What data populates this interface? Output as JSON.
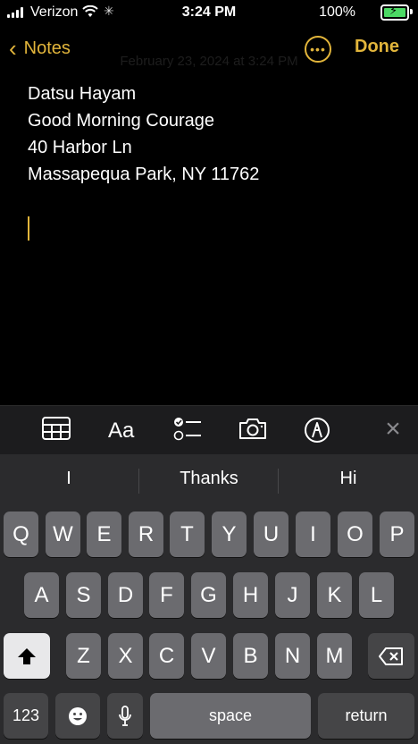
{
  "status_bar": {
    "carrier": "Verizon",
    "time": "3:24 PM",
    "battery_percent": "100%",
    "battery_level": 1.0
  },
  "nav": {
    "back_label": "Notes",
    "done_label": "Done",
    "date_faint": "February 23, 2024 at 3:24 PM"
  },
  "note": {
    "lines": [
      "Datsu Hayam",
      "Good Morning Courage",
      "40 Harbor Ln",
      "Massapequa Park, NY 11762"
    ]
  },
  "toolbar": {
    "items": [
      "table-icon",
      "text-format-label",
      "checklist-icon",
      "camera-icon",
      "markup-pen-icon"
    ],
    "format_label": "Aa"
  },
  "keyboard": {
    "predictions": [
      "I",
      "Thanks",
      "Hi"
    ],
    "row1": [
      "Q",
      "W",
      "E",
      "R",
      "T",
      "Y",
      "U",
      "I",
      "O",
      "P"
    ],
    "row2": [
      "A",
      "S",
      "D",
      "F",
      "G",
      "H",
      "J",
      "K",
      "L"
    ],
    "row3": [
      "Z",
      "X",
      "C",
      "V",
      "B",
      "N",
      "M"
    ],
    "numbers_label": "123",
    "space_label": "space",
    "return_label": "return"
  },
  "colors": {
    "accent": "#e2b53b",
    "background": "#000000",
    "keyboard_bg": "#2b2b2d",
    "key": "#6b6b6f"
  }
}
